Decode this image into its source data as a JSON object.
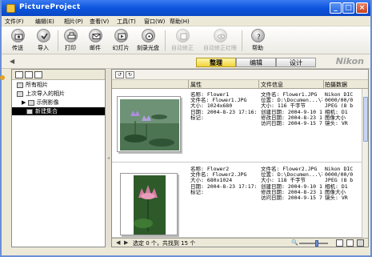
{
  "window": {
    "title": "PictureProject",
    "min": "_",
    "max": "□",
    "close": "×"
  },
  "menu": [
    "文件(F)",
    "编辑(E)",
    "相片(P)",
    "查看(V)",
    "工具(T)",
    "窗口(W)",
    "帮助(H)"
  ],
  "toolbar": [
    {
      "label": "传送",
      "icon": "transfer-icon",
      "enabled": true
    },
    {
      "label": "导入",
      "icon": "import-icon",
      "enabled": true
    },
    {
      "label": "打印",
      "icon": "print-icon",
      "enabled": true
    },
    {
      "label": "邮件",
      "icon": "mail-icon",
      "enabled": true
    },
    {
      "label": "幻灯片",
      "icon": "slideshow-icon",
      "enabled": true
    },
    {
      "label": "刻录光盘",
      "icon": "burn-disc-icon",
      "enabled": true
    },
    {
      "label": "自动修正",
      "icon": "auto-enhance-icon",
      "enabled": false
    },
    {
      "label": "自动修正红眼",
      "icon": "red-eye-icon",
      "enabled": false
    },
    {
      "label": "帮助",
      "icon": "help-icon",
      "enabled": true
    }
  ],
  "tabs": [
    {
      "label": "整理",
      "active": true
    },
    {
      "label": "编辑",
      "active": false
    },
    {
      "label": "设计",
      "active": false
    }
  ],
  "brand": "Nikon",
  "sidebar": {
    "items": [
      {
        "label": "所有相片",
        "indent": 0,
        "selected": false
      },
      {
        "label": "上次导入的相片",
        "indent": 0,
        "selected": false
      },
      {
        "label": "示例影像",
        "indent": 1,
        "selected": false,
        "expander": "▶"
      },
      {
        "label": "新建集合",
        "indent": 1,
        "selected": true
      }
    ]
  },
  "columns": {
    "prop": "属性",
    "file": "文件信息",
    "shoot": "拍摄数据"
  },
  "photos": [
    {
      "prop": [
        "名称: Flower1",
        "文件名: Flower1.JPG",
        "大小: 1024x680",
        "日期: 2004-8-23 17:16:12",
        "标记:"
      ],
      "file": [
        "文件名: Flower1.JPG",
        "位置: D:\\Documen...\\花卉",
        "大小: 116 千字节",
        "创建日期: 2004-9-10 1...",
        "修改日期: 2004-8-23 1...",
        "访问日期: 2004-9-15 7..."
      ],
      "shoot": [
        "Nikon DIC",
        "0000/00/0",
        "JPEG (8 b",
        "相机: D1",
        "图像大小",
        "镜头: VR"
      ]
    },
    {
      "prop": [
        "名称: Flower2",
        "文件名: Flower2.JPG",
        "大小: 680x1024",
        "日期: 2004-8-23 17:17:18",
        "标记:"
      ],
      "file": [
        "文件名: Flower2.JPG",
        "位置: D:\\Documen...\\花卉",
        "大小: 118 千字节",
        "创建日期: 2004-9-10 1...",
        "修改日期: 2004-8-23 1...",
        "访问日期: 2004-9-15 7..."
      ],
      "shoot": [
        "Nikon DIC",
        "0000/00/0",
        "JPEG (8 b",
        "相机: D1",
        "图像大小",
        "镜头: VR"
      ]
    }
  ],
  "status": {
    "text": "选定 0 个，共找到 15 个",
    "prev": "◀",
    "next": "▶",
    "zoom_icon": "🔍"
  },
  "colors": {
    "accent": "#0c55de",
    "tab_active": "#f2d33a",
    "selection": "#000000"
  }
}
